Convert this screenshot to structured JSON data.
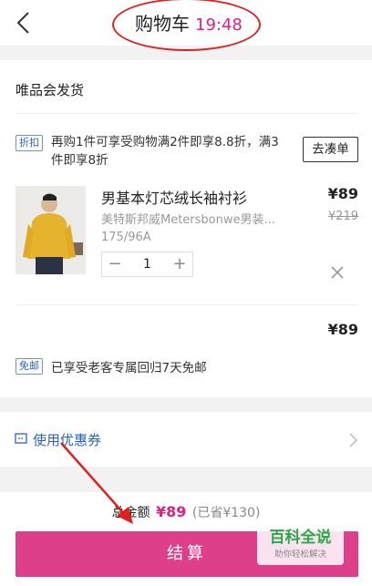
{
  "header": {
    "title": "购物车",
    "time": "19:48"
  },
  "cart": {
    "vendor": "唯品会发货",
    "promo": {
      "tag": "折扣",
      "text": "再购1件可享受购物满2件即享8.8折，满3件即享8折",
      "button": "去凑单"
    },
    "item": {
      "name": "男基本灯芯绒长袖衬衫",
      "brand": "美特斯邦威Metersbonwe男装...",
      "spec": "175/96A",
      "price": "¥89",
      "original_price": "¥219",
      "quantity": "1",
      "minus": "−",
      "plus": "+"
    },
    "subtotal": "¥89",
    "shipping": {
      "tag": "免邮",
      "text": "已享受老客专属回归7天免邮"
    }
  },
  "coupon": {
    "label": "使用优惠券"
  },
  "footer": {
    "total_label": "总金额",
    "total_value": "¥89",
    "saved": "(已省¥130)",
    "checkout": "结算"
  },
  "watermark": {
    "main": "百科全说",
    "sub": "助你轻松解决"
  },
  "colors": {
    "accent": "#dd3f8b",
    "price_pink": "#e0207d",
    "link_blue": "#2a63c7",
    "annotation_red": "#e02020"
  }
}
